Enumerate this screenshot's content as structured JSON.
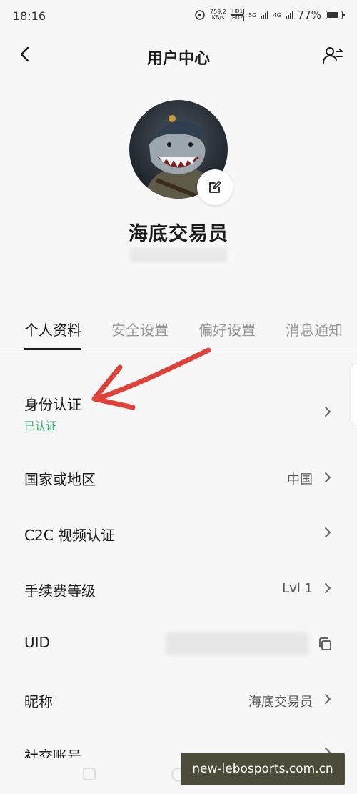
{
  "status_bar": {
    "time": "18:16",
    "net_speed_value": "759.2",
    "net_speed_unit": "KB/s",
    "hd_top": "HD1",
    "hd_bottom": "HD2",
    "net1": "5G",
    "net2": "4G",
    "battery_text": "77%",
    "battery_level": 0.77
  },
  "nav": {
    "title": "用户中心",
    "back_icon": "chevron-left-icon",
    "switch_icon": "user-switch-icon"
  },
  "profile": {
    "username": "海底交易员",
    "avatar_icon": "shark-avatar",
    "edit_icon": "edit-icon"
  },
  "tabs": [
    {
      "label": "个人资料",
      "active": true
    },
    {
      "label": "安全设置",
      "active": false
    },
    {
      "label": "偏好设置",
      "active": false
    },
    {
      "label": "消息通知",
      "active": false
    }
  ],
  "rows": {
    "identity": {
      "label": "身份认证",
      "sub": "已认证"
    },
    "country": {
      "label": "国家或地区",
      "value": "中国"
    },
    "c2c": {
      "label": "C2C 视频认证"
    },
    "fee": {
      "label": "手续费等级",
      "value": "Lvl 1"
    },
    "uid": {
      "label": "UID"
    },
    "nickname": {
      "label": "昵称",
      "value": "海底交易员"
    },
    "social": {
      "label": "社交账号"
    }
  },
  "colors": {
    "accent_green": "#2fae6e",
    "annotation_arrow": "#e0423a"
  },
  "watermark": {
    "text": "new-lebosports.com.cn"
  }
}
